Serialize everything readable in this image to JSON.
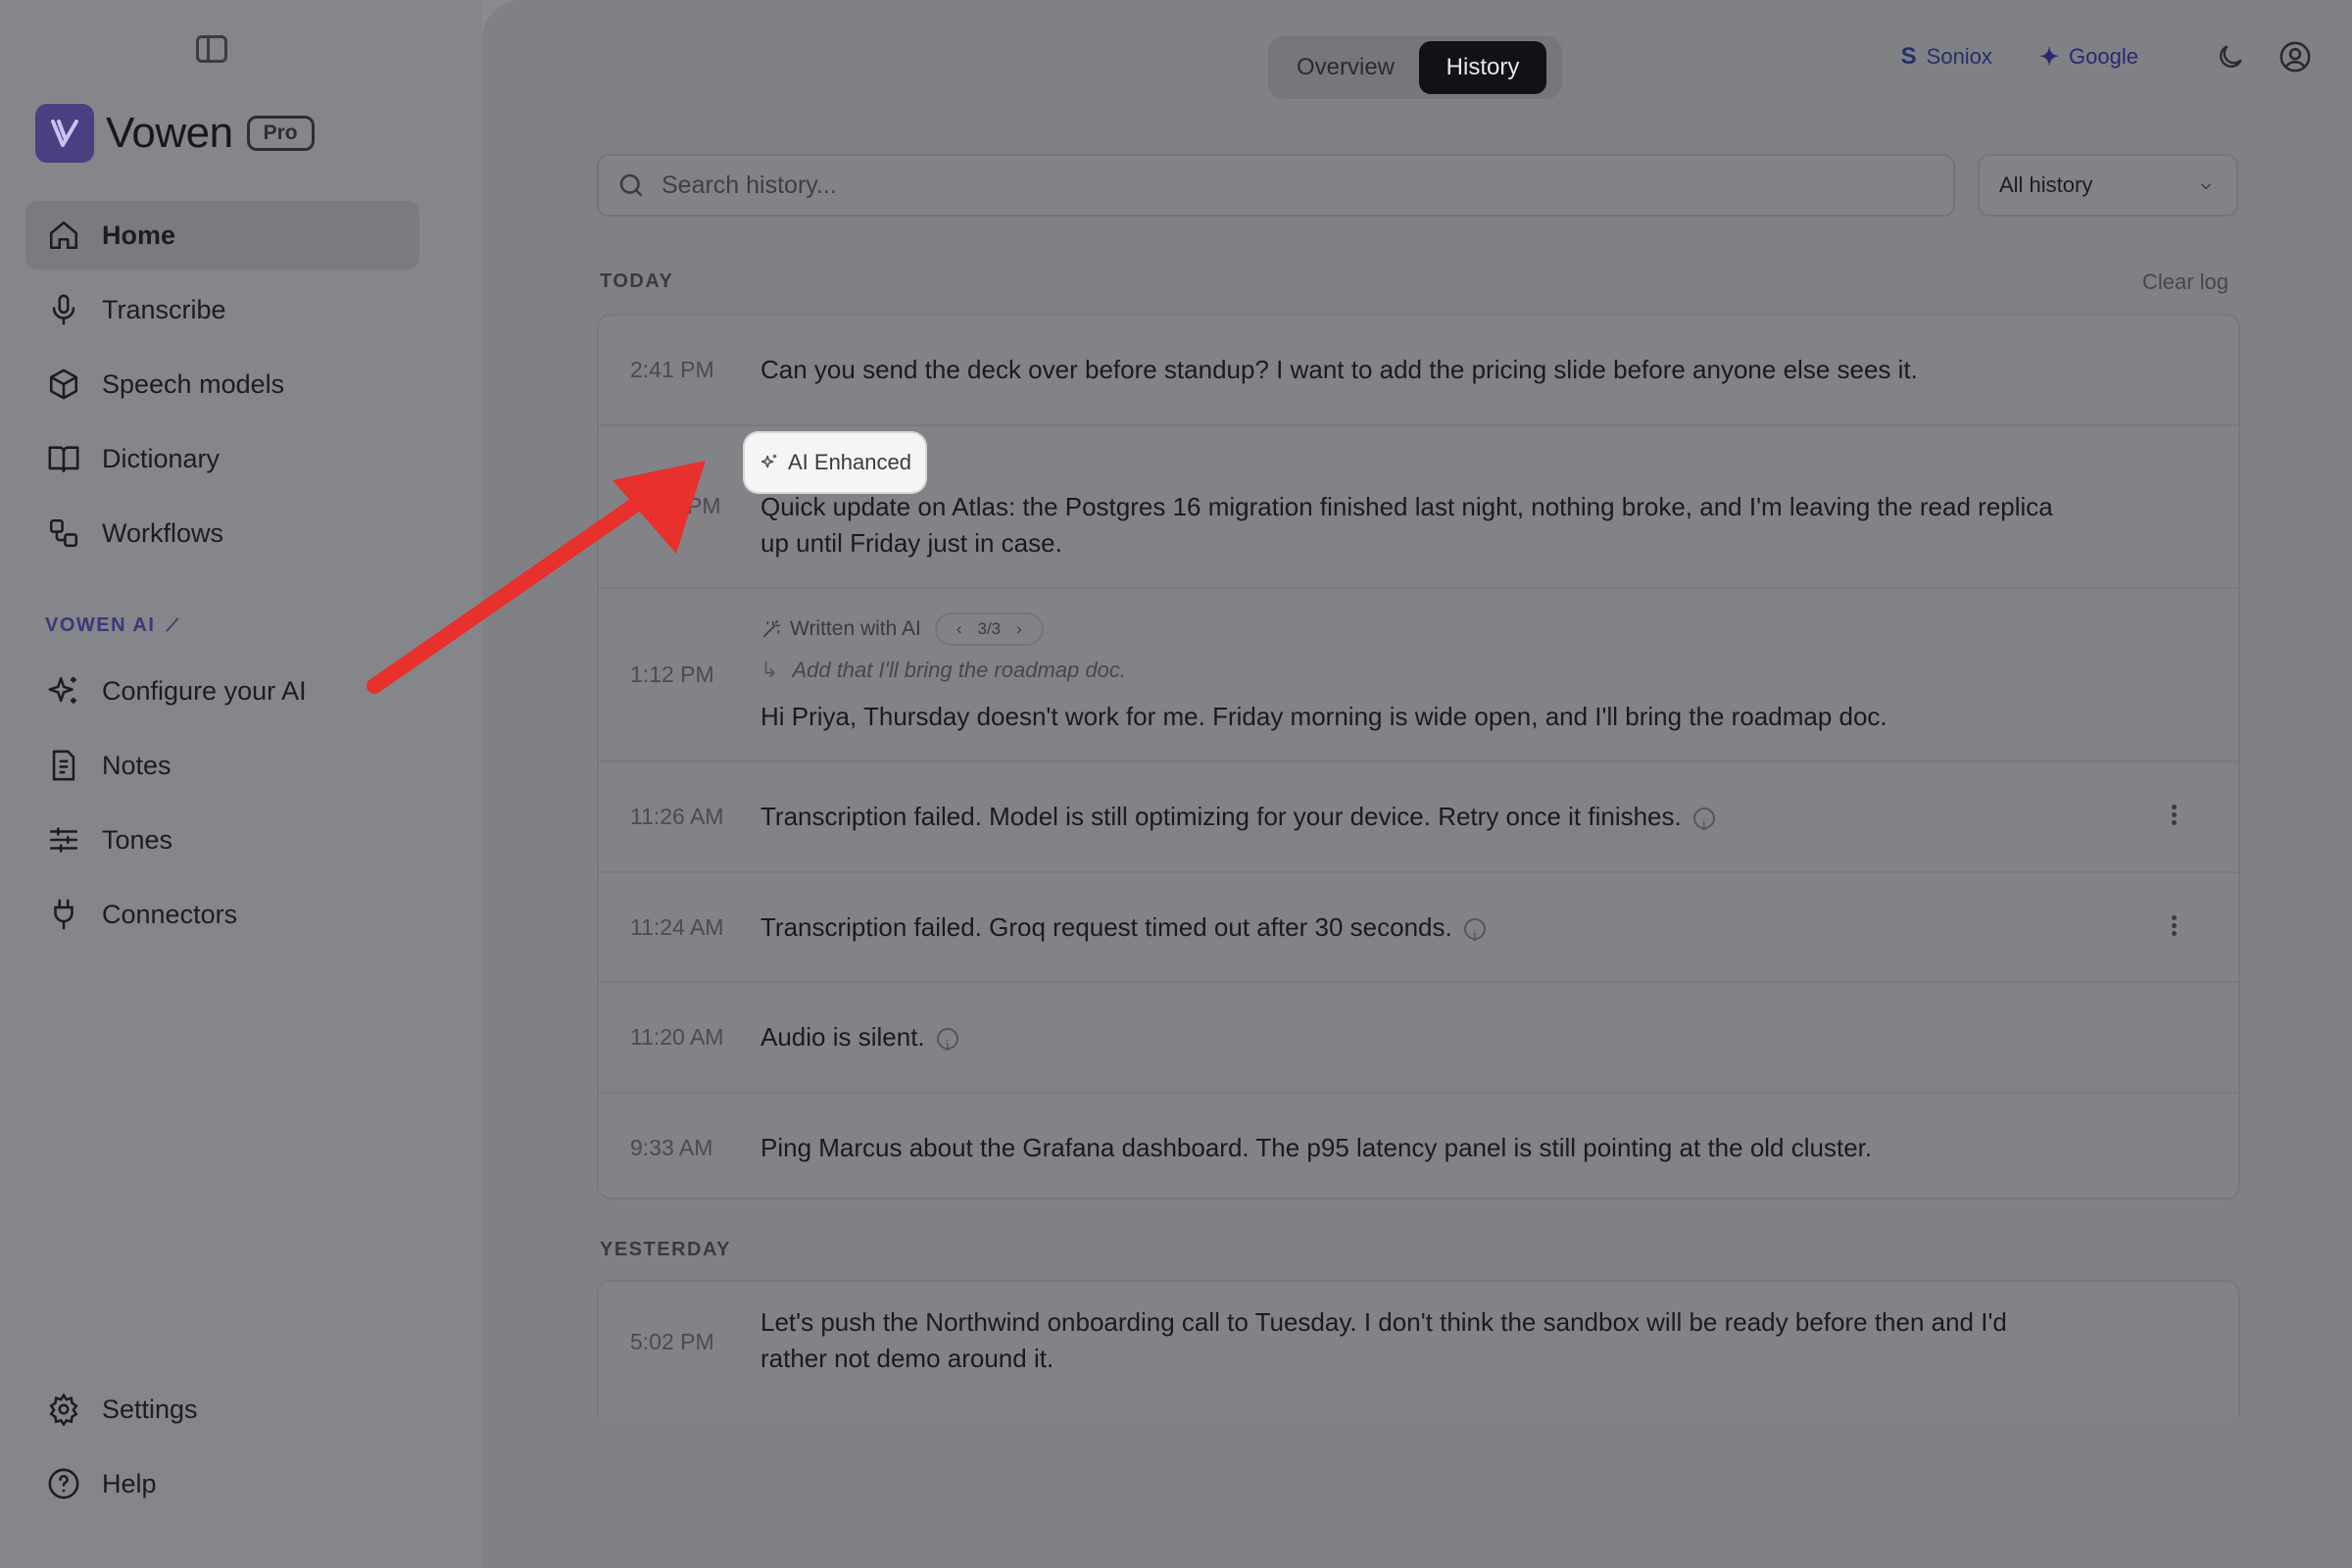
{
  "app": {
    "name": "Vowen",
    "plan_badge": "Pro"
  },
  "sidebar": {
    "items": [
      {
        "label": "Home"
      },
      {
        "label": "Transcribe"
      },
      {
        "label": "Speech models"
      },
      {
        "label": "Dictionary"
      },
      {
        "label": "Workflows"
      }
    ],
    "section_label": "VOWEN AI",
    "ai_items": [
      {
        "label": "Configure your AI"
      },
      {
        "label": "Notes"
      },
      {
        "label": "Tones"
      },
      {
        "label": "Connectors"
      }
    ],
    "bottom_items": [
      {
        "label": "Settings"
      },
      {
        "label": "Help"
      }
    ]
  },
  "header": {
    "tabs": [
      "Overview",
      "History"
    ],
    "active_tab": "History",
    "providers": [
      {
        "glyph": "S",
        "label": "Soniox"
      },
      {
        "glyph": "✦",
        "label": "Google"
      }
    ]
  },
  "search": {
    "placeholder": "Search history...",
    "filter_value": "All history"
  },
  "history": {
    "today_label": "TODAY",
    "clear_label": "Clear log",
    "yesterday_label": "YESTERDAY",
    "today": [
      {
        "time": "2:41 PM",
        "text": "Can you send the deck over before standup? I want to add the pricing slide before anyone else sees it."
      },
      {
        "time": "PM",
        "badge": "AI Enhanced",
        "text": "Quick update on Atlas: the Postgres 16 migration finished last night, nothing broke, and I'm leaving the read replica up until Friday just in case."
      },
      {
        "time": "1:12 PM",
        "written_label": "Written with AI",
        "pager": "3/3",
        "instruction": "Add that I'll bring the roadmap doc.",
        "text": "Hi Priya, Thursday doesn't work for me. Friday morning is wide open, and I'll bring the roadmap doc."
      },
      {
        "time": "11:26 AM",
        "text": "Transcription failed. Model is still optimizing for your device. Retry once it finishes."
      },
      {
        "time": "11:24 AM",
        "text": "Transcription failed. Groq request timed out after 30 seconds."
      },
      {
        "time": "11:20 AM",
        "text": "Audio is silent."
      },
      {
        "time": "9:33 AM",
        "text": "Ping Marcus about the Grafana dashboard. The p95 latency panel is still pointing at the old cluster."
      }
    ],
    "yesterday": [
      {
        "time": "5:02 PM",
        "text": "Let's push the Northwind onboarding call to Tuesday. I don't think the sandbox will be ready before then and I'd rather not demo around it."
      }
    ]
  },
  "colors": {
    "accent": "#4a3f80",
    "annotation_arrow": "#e8302d"
  }
}
